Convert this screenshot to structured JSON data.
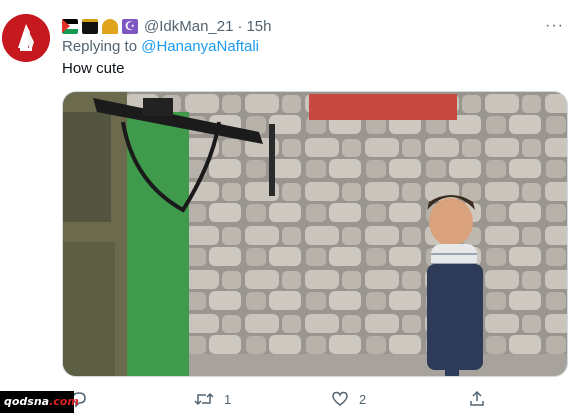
{
  "tweet": {
    "handle": "@IdkMan_21",
    "separator": "·",
    "time": "15h",
    "reply_prefix": "Replying to",
    "reply_to": "@HananyaNaftali",
    "text": "How cute",
    "more_label": "···"
  },
  "header_icons": [
    "palestine-flag-icon",
    "kaaba-icon",
    "mosque-icon",
    "crescent-icon"
  ],
  "actions": {
    "reply_count": "",
    "retweet_count": "1",
    "like_count": "2",
    "share_count": ""
  },
  "watermark": {
    "name": "qodsna",
    "ext": ".com"
  },
  "colors": {
    "link": "#1d9bf0",
    "muted": "#536471",
    "avatar_bg": "#c5191f"
  }
}
